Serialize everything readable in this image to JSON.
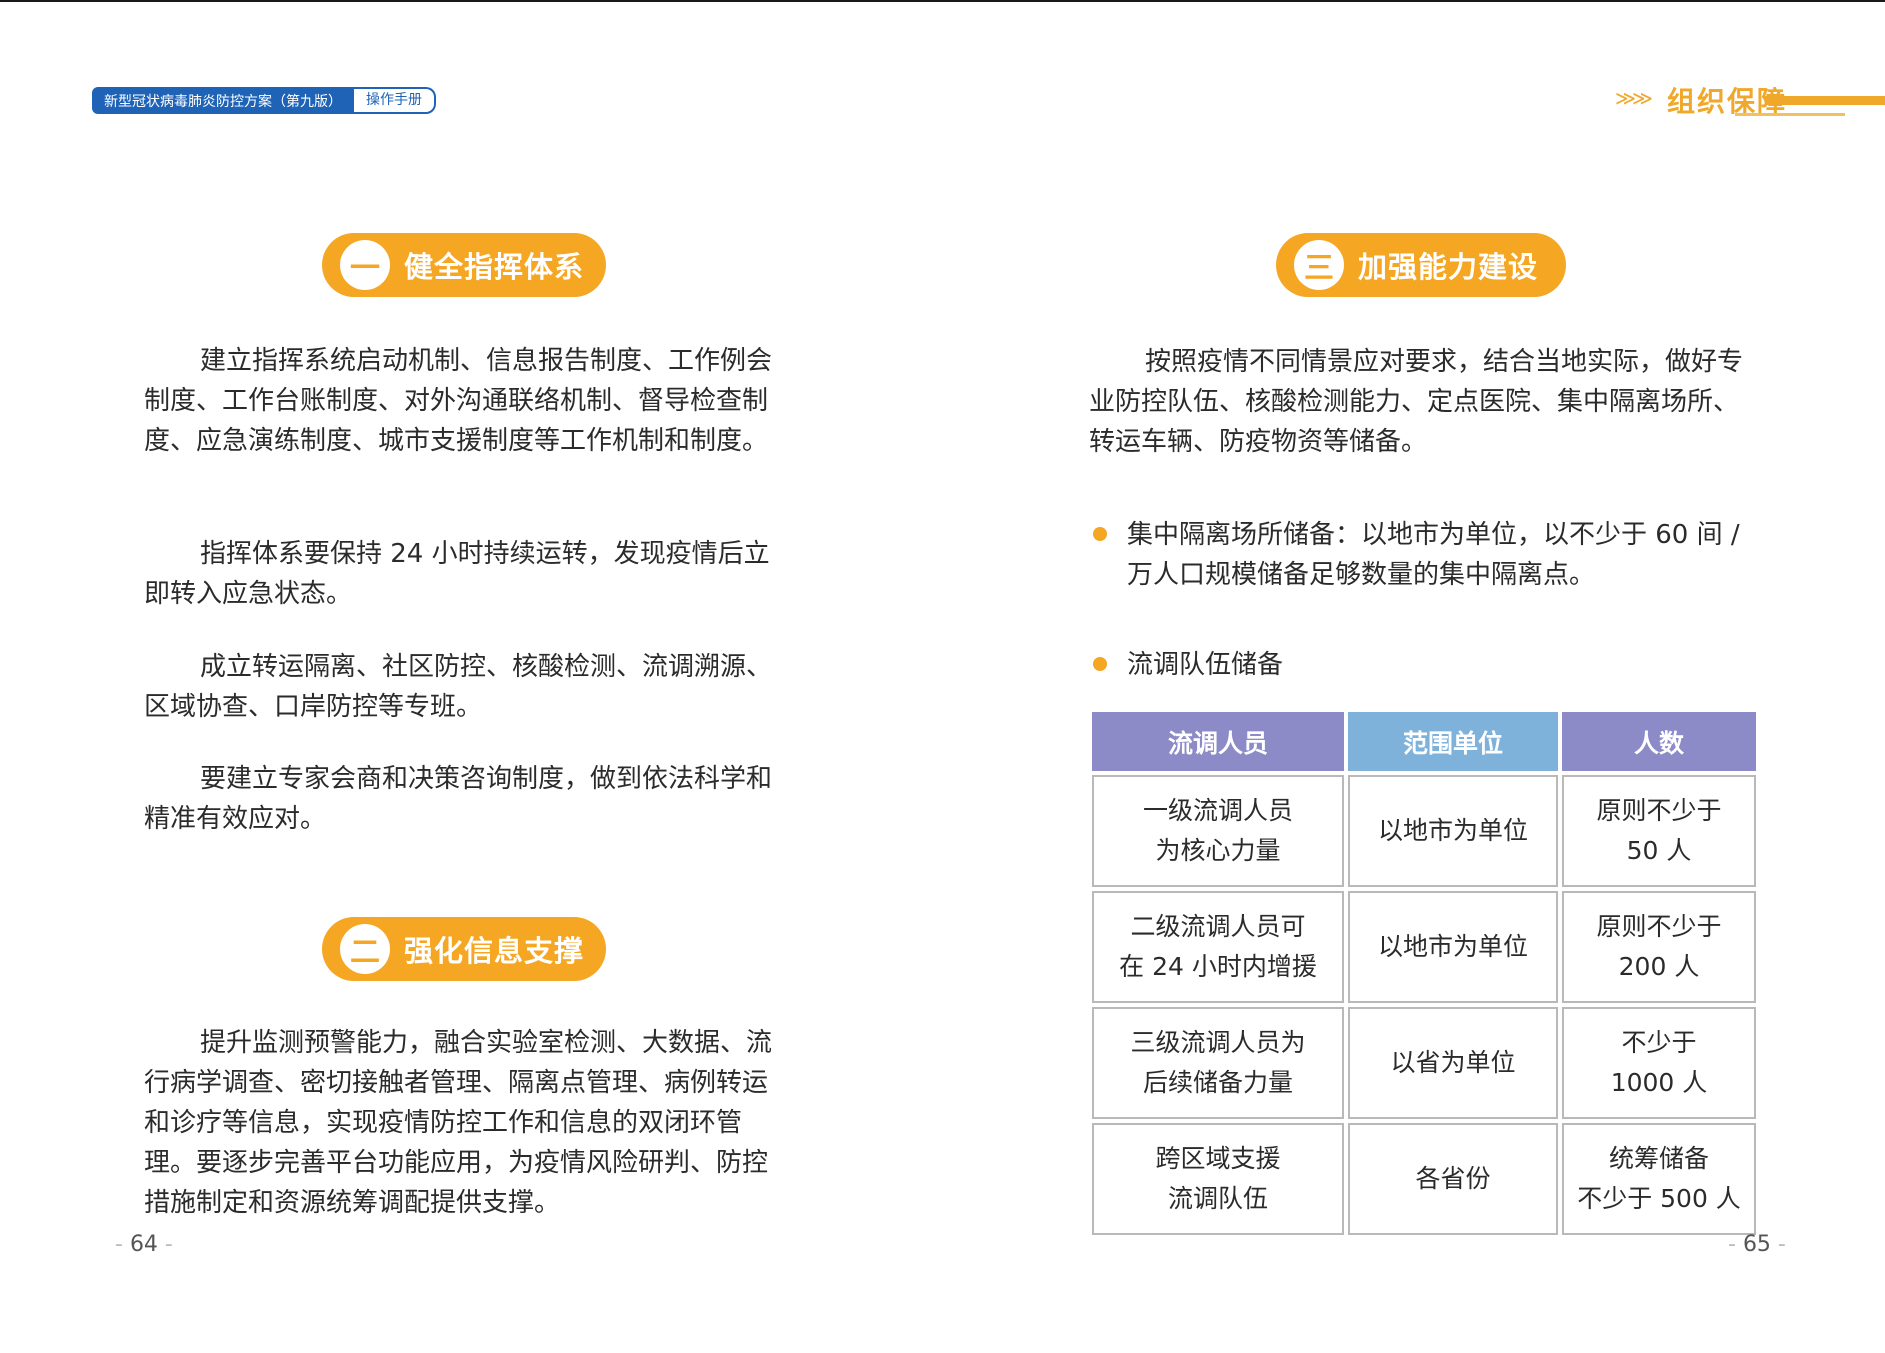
{
  "header": {
    "left_title": "新型冠状病毒肺炎防控方案（第九版）",
    "left_tag": "操作手册",
    "right_label": "组织保障",
    "right_deco": "≫≫"
  },
  "left_page": {
    "section1": {
      "number": "一",
      "title": "健全指挥体系",
      "paragraphs": [
        "建立指挥系统启动机制、信息报告制度、工作例会制度、工作台账制度、对外沟通联络机制、督导检查制度、应急演练制度、城市支援制度等工作机制和制度。",
        "指挥体系要保持 24 小时持续运转，发现疫情后立即转入应急状态。",
        "成立转运隔离、社区防控、核酸检测、流调溯源、区域协查、口岸防控等专班。",
        "要建立专家会商和决策咨询制度，做到依法科学和精准有效应对。"
      ]
    },
    "section2": {
      "number": "二",
      "title": "强化信息支撑",
      "paragraph": "提升监测预警能力，融合实验室检测、大数据、流行病学调查、密切接触者管理、隔离点管理、病例转运和诊疗等信息，实现疫情防控工作和信息的双闭环管理。要逐步完善平台功能应用，为疫情风险研判、防控措施制定和资源统筹调配提供支撑。"
    },
    "page_number": "64"
  },
  "right_page": {
    "section3": {
      "number": "三",
      "title": "加强能力建设",
      "intro": "按照疫情不同情景应对要求，结合当地实际，做好专业防控队伍、核酸检测能力、定点医院、集中隔离场所、转运车辆、防疫物资等储备。",
      "bullets": [
        "集中隔离场所储备：以地市为单位，以不少于 60 间 / 万人口规模储备足够数量的集中隔离点。",
        "流调队伍储备"
      ]
    },
    "table": {
      "headers": [
        "流调人员",
        "范围单位",
        "人数"
      ],
      "rows": [
        [
          "一级流调人员\n为核心力量",
          "以地市为单位",
          "原则不少于\n50 人"
        ],
        [
          "二级流调人员可\n在 24 小时内增援",
          "以地市为单位",
          "原则不少于\n200 人"
        ],
        [
          "三级流调人员为\n后续储备力量",
          "以省为单位",
          "不少于\n1000 人"
        ],
        [
          "跨区域支援\n流调队伍",
          "各省份",
          "统筹储备\n不少于 500 人"
        ]
      ]
    },
    "page_number": "65"
  },
  "colors": {
    "accent_orange": "#f5a623",
    "header_blue": "#1f63b6",
    "table_purple": "#8c8bc8",
    "table_blue": "#7fb2da"
  }
}
